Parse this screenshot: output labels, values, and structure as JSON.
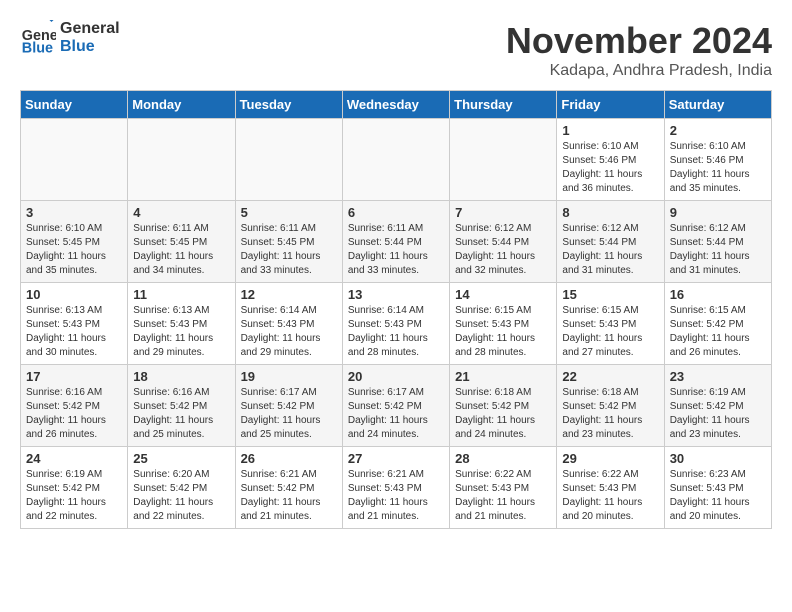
{
  "header": {
    "logo_line1": "General",
    "logo_line2": "Blue",
    "title": "November 2024",
    "location": "Kadapa, Andhra Pradesh, India"
  },
  "days_of_week": [
    "Sunday",
    "Monday",
    "Tuesday",
    "Wednesday",
    "Thursday",
    "Friday",
    "Saturday"
  ],
  "weeks": [
    [
      {
        "day": "",
        "info": ""
      },
      {
        "day": "",
        "info": ""
      },
      {
        "day": "",
        "info": ""
      },
      {
        "day": "",
        "info": ""
      },
      {
        "day": "",
        "info": ""
      },
      {
        "day": "1",
        "info": "Sunrise: 6:10 AM\nSunset: 5:46 PM\nDaylight: 11 hours\nand 36 minutes."
      },
      {
        "day": "2",
        "info": "Sunrise: 6:10 AM\nSunset: 5:46 PM\nDaylight: 11 hours\nand 35 minutes."
      }
    ],
    [
      {
        "day": "3",
        "info": "Sunrise: 6:10 AM\nSunset: 5:45 PM\nDaylight: 11 hours\nand 35 minutes."
      },
      {
        "day": "4",
        "info": "Sunrise: 6:11 AM\nSunset: 5:45 PM\nDaylight: 11 hours\nand 34 minutes."
      },
      {
        "day": "5",
        "info": "Sunrise: 6:11 AM\nSunset: 5:45 PM\nDaylight: 11 hours\nand 33 minutes."
      },
      {
        "day": "6",
        "info": "Sunrise: 6:11 AM\nSunset: 5:44 PM\nDaylight: 11 hours\nand 33 minutes."
      },
      {
        "day": "7",
        "info": "Sunrise: 6:12 AM\nSunset: 5:44 PM\nDaylight: 11 hours\nand 32 minutes."
      },
      {
        "day": "8",
        "info": "Sunrise: 6:12 AM\nSunset: 5:44 PM\nDaylight: 11 hours\nand 31 minutes."
      },
      {
        "day": "9",
        "info": "Sunrise: 6:12 AM\nSunset: 5:44 PM\nDaylight: 11 hours\nand 31 minutes."
      }
    ],
    [
      {
        "day": "10",
        "info": "Sunrise: 6:13 AM\nSunset: 5:43 PM\nDaylight: 11 hours\nand 30 minutes."
      },
      {
        "day": "11",
        "info": "Sunrise: 6:13 AM\nSunset: 5:43 PM\nDaylight: 11 hours\nand 29 minutes."
      },
      {
        "day": "12",
        "info": "Sunrise: 6:14 AM\nSunset: 5:43 PM\nDaylight: 11 hours\nand 29 minutes."
      },
      {
        "day": "13",
        "info": "Sunrise: 6:14 AM\nSunset: 5:43 PM\nDaylight: 11 hours\nand 28 minutes."
      },
      {
        "day": "14",
        "info": "Sunrise: 6:15 AM\nSunset: 5:43 PM\nDaylight: 11 hours\nand 28 minutes."
      },
      {
        "day": "15",
        "info": "Sunrise: 6:15 AM\nSunset: 5:43 PM\nDaylight: 11 hours\nand 27 minutes."
      },
      {
        "day": "16",
        "info": "Sunrise: 6:15 AM\nSunset: 5:42 PM\nDaylight: 11 hours\nand 26 minutes."
      }
    ],
    [
      {
        "day": "17",
        "info": "Sunrise: 6:16 AM\nSunset: 5:42 PM\nDaylight: 11 hours\nand 26 minutes."
      },
      {
        "day": "18",
        "info": "Sunrise: 6:16 AM\nSunset: 5:42 PM\nDaylight: 11 hours\nand 25 minutes."
      },
      {
        "day": "19",
        "info": "Sunrise: 6:17 AM\nSunset: 5:42 PM\nDaylight: 11 hours\nand 25 minutes."
      },
      {
        "day": "20",
        "info": "Sunrise: 6:17 AM\nSunset: 5:42 PM\nDaylight: 11 hours\nand 24 minutes."
      },
      {
        "day": "21",
        "info": "Sunrise: 6:18 AM\nSunset: 5:42 PM\nDaylight: 11 hours\nand 24 minutes."
      },
      {
        "day": "22",
        "info": "Sunrise: 6:18 AM\nSunset: 5:42 PM\nDaylight: 11 hours\nand 23 minutes."
      },
      {
        "day": "23",
        "info": "Sunrise: 6:19 AM\nSunset: 5:42 PM\nDaylight: 11 hours\nand 23 minutes."
      }
    ],
    [
      {
        "day": "24",
        "info": "Sunrise: 6:19 AM\nSunset: 5:42 PM\nDaylight: 11 hours\nand 22 minutes."
      },
      {
        "day": "25",
        "info": "Sunrise: 6:20 AM\nSunset: 5:42 PM\nDaylight: 11 hours\nand 22 minutes."
      },
      {
        "day": "26",
        "info": "Sunrise: 6:21 AM\nSunset: 5:42 PM\nDaylight: 11 hours\nand 21 minutes."
      },
      {
        "day": "27",
        "info": "Sunrise: 6:21 AM\nSunset: 5:43 PM\nDaylight: 11 hours\nand 21 minutes."
      },
      {
        "day": "28",
        "info": "Sunrise: 6:22 AM\nSunset: 5:43 PM\nDaylight: 11 hours\nand 21 minutes."
      },
      {
        "day": "29",
        "info": "Sunrise: 6:22 AM\nSunset: 5:43 PM\nDaylight: 11 hours\nand 20 minutes."
      },
      {
        "day": "30",
        "info": "Sunrise: 6:23 AM\nSunset: 5:43 PM\nDaylight: 11 hours\nand 20 minutes."
      }
    ]
  ]
}
